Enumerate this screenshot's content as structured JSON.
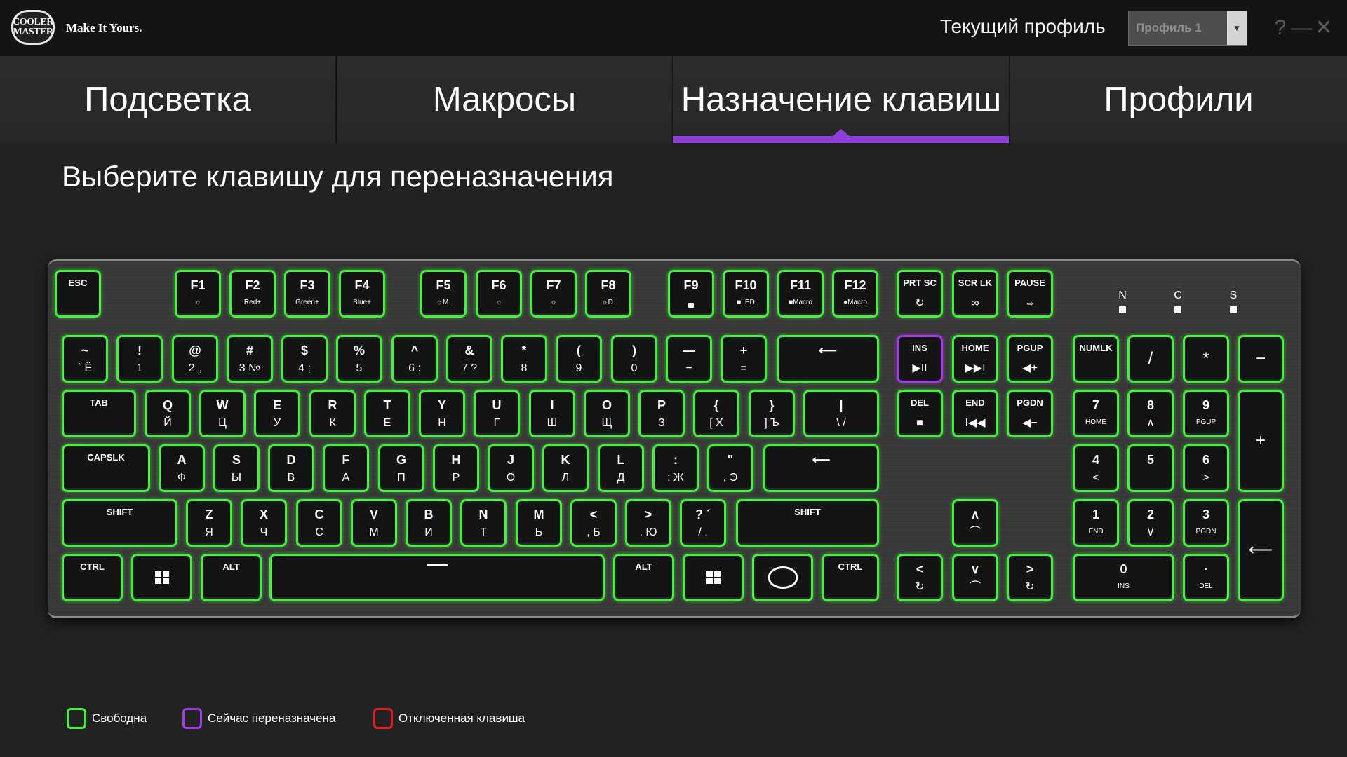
{
  "header": {
    "logo_line1": "COOLER",
    "logo_line2": "MASTER",
    "tagline": "Make It Yours.",
    "profile_label": "Текущий профиль",
    "profile_value": "Профиль 1",
    "help": "?",
    "minimize": "—",
    "close": "✕"
  },
  "tabs": [
    {
      "label": "Подсветка"
    },
    {
      "label": "Макросы"
    },
    {
      "label": "Назначение клавиш"
    },
    {
      "label": "Профили"
    }
  ],
  "page": {
    "title": "Выберите клавишу для переназначения"
  },
  "lock_indicators": [
    "N",
    "C",
    "S"
  ],
  "keys": {
    "esc": {
      "top": "ESC"
    },
    "f1": {
      "top": "F1",
      "bot": "☼"
    },
    "f2": {
      "top": "F2",
      "bot": "Red+"
    },
    "f3": {
      "top": "F3",
      "bot": "Green+"
    },
    "f4": {
      "top": "F4",
      "bot": "Blue+"
    },
    "f5": {
      "top": "F5",
      "bot": "☼M."
    },
    "f6": {
      "top": "F6",
      "bot": "☼"
    },
    "f7": {
      "top": "F7",
      "bot": "☼"
    },
    "f8": {
      "top": "F8",
      "bot": "☼D."
    },
    "f9": {
      "top": "F9"
    },
    "f10": {
      "top": "F10",
      "bot": "■LED"
    },
    "f11": {
      "top": "F11",
      "bot": "■Macro"
    },
    "f12": {
      "top": "F12",
      "bot": "●Macro"
    },
    "prtsc": {
      "top": "PRT SC",
      "bot": "↻"
    },
    "scrlk": {
      "top": "SCR LK",
      "bot": "∞"
    },
    "pause": {
      "top": "PAUSE",
      "bot": "⇔"
    },
    "tilde": {
      "top": "~",
      "bot": "` Ё"
    },
    "k1": {
      "top": "!",
      "bot": "1"
    },
    "k2": {
      "top": "@",
      "bot": "2 „"
    },
    "k3": {
      "top": "#",
      "bot": "3 №"
    },
    "k4": {
      "top": "$",
      "bot": "4 ;"
    },
    "k5": {
      "top": "%",
      "bot": "5"
    },
    "k6": {
      "top": "^",
      "bot": "6 :"
    },
    "k7": {
      "top": "&",
      "bot": "7 ?"
    },
    "k8": {
      "top": "*",
      "bot": "8"
    },
    "k9": {
      "top": "(",
      "bot": "9"
    },
    "k0": {
      "top": ")",
      "bot": "0"
    },
    "minus": {
      "top": "—",
      "bot": "−"
    },
    "equals": {
      "top": "+",
      "bot": "="
    },
    "backspace": {
      "top": "⟵"
    },
    "ins": {
      "top": "INS",
      "bot": "▶II"
    },
    "home": {
      "top": "HOME",
      "bot": "▶▶I"
    },
    "pgup": {
      "top": "PGUP",
      "bot": "◀+"
    },
    "numlk": {
      "top": "NUMLK"
    },
    "np_div": {
      "center": "/"
    },
    "np_mul": {
      "center": "*"
    },
    "np_sub": {
      "center": "−"
    },
    "tab": {
      "top": "TAB"
    },
    "q": {
      "top": "Q",
      "bot": "Й"
    },
    "w": {
      "top": "W",
      "bot": "Ц"
    },
    "e": {
      "top": "E",
      "bot": "У"
    },
    "r": {
      "top": "R",
      "bot": "К"
    },
    "t": {
      "top": "T",
      "bot": "Е"
    },
    "y": {
      "top": "Y",
      "bot": "Н"
    },
    "u": {
      "top": "U",
      "bot": "Г"
    },
    "i": {
      "top": "I",
      "bot": "Ш"
    },
    "o": {
      "top": "O",
      "bot": "Щ"
    },
    "p": {
      "top": "P",
      "bot": "З"
    },
    "lbracket": {
      "top": "{",
      "bot": "[ Х"
    },
    "rbracket": {
      "top": "}",
      "bot": "] Ъ"
    },
    "backslash": {
      "top": "|",
      "bot": "\\ /"
    },
    "del": {
      "top": "DEL",
      "bot": "■"
    },
    "end": {
      "top": "END",
      "bot": "I◀◀"
    },
    "pgdn": {
      "top": "PGDN",
      "bot": "◀−"
    },
    "np7": {
      "top": "7",
      "bot": "HOME"
    },
    "np8": {
      "top": "8",
      "bot": "∧"
    },
    "np9": {
      "top": "9",
      "bot": "PGUP"
    },
    "np_add": {
      "center": "+"
    },
    "capslk": {
      "top": "CAPSLK"
    },
    "a": {
      "top": "A",
      "bot": "Ф"
    },
    "s": {
      "top": "S",
      "bot": "Ы"
    },
    "d": {
      "top": "D",
      "bot": "В"
    },
    "f": {
      "top": "F",
      "bot": "А"
    },
    "g": {
      "top": "G",
      "bot": "П"
    },
    "h": {
      "top": "H",
      "bot": "Р"
    },
    "j": {
      "top": "J",
      "bot": "О"
    },
    "k": {
      "top": "K",
      "bot": "Л"
    },
    "l": {
      "top": "L",
      "bot": "Д"
    },
    "semicolon": {
      "top": ":",
      "bot": "; Ж"
    },
    "quote": {
      "top": "\"",
      "bot": ", Э"
    },
    "enter": {
      "top": "⟵"
    },
    "np4": {
      "top": "4",
      "bot": "<"
    },
    "np5": {
      "top": "5"
    },
    "np6": {
      "top": "6",
      "bot": ">"
    },
    "lshift": {
      "top": "SHIFT"
    },
    "z": {
      "top": "Z",
      "bot": "Я"
    },
    "x": {
      "top": "X",
      "bot": "Ч"
    },
    "c": {
      "top": "C",
      "bot": "С"
    },
    "v": {
      "top": "V",
      "bot": "М"
    },
    "b": {
      "top": "B",
      "bot": "И"
    },
    "n": {
      "top": "N",
      "bot": "Т"
    },
    "m": {
      "top": "M",
      "bot": "Ь"
    },
    "comma": {
      "top": "<",
      "bot": ", Б"
    },
    "period": {
      "top": ">",
      "bot": ". Ю"
    },
    "slash": {
      "top": "? ´",
      "bot": "/ ."
    },
    "rshift": {
      "top": "SHIFT"
    },
    "up": {
      "top": "∧",
      "bot": "⌒"
    },
    "np1": {
      "top": "1",
      "bot": "END"
    },
    "np2": {
      "top": "2",
      "bot": "∨"
    },
    "np3": {
      "top": "3",
      "bot": "PGDN"
    },
    "np_enter": {
      "center": "⟵"
    },
    "lctrl": {
      "top": "CTRL"
    },
    "lwin": {},
    "lalt": {
      "top": "ALT"
    },
    "space": {},
    "ralt": {
      "top": "ALT"
    },
    "rwin": {},
    "fn": {},
    "rctrl": {
      "top": "CTRL"
    },
    "left": {
      "top": "<",
      "bot": "↻"
    },
    "down": {
      "top": "∨",
      "bot": "⌒"
    },
    "right": {
      "top": ">",
      "bot": "↻"
    },
    "np0": {
      "top": "0",
      "bot": "INS"
    },
    "np_dot": {
      "top": "·",
      "bot": "DEL"
    }
  },
  "legend": [
    {
      "label": "Свободна",
      "color": "#3ff23a"
    },
    {
      "label": "Сейчас переназначена",
      "color": "#a53be8"
    },
    {
      "label": "Отключенная клавиша",
      "color": "#e02020"
    }
  ],
  "colors": {
    "accent": "#8b3fd8",
    "key_glow": "#3ff23a",
    "remapped": "#a53be8",
    "disabled": "#e02020"
  }
}
